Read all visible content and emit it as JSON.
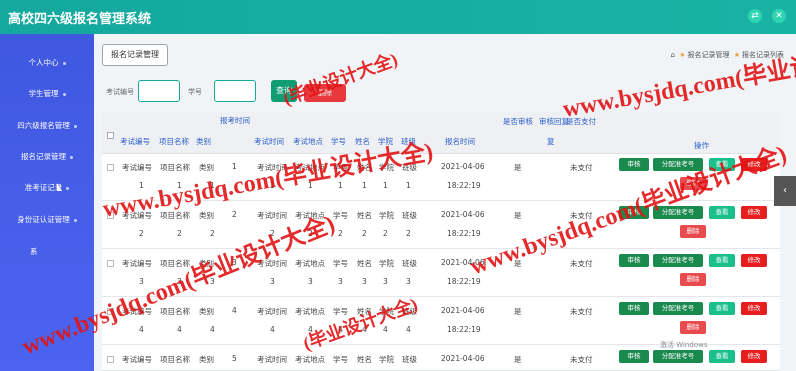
{
  "app": {
    "title": "高校四六级报名管理系统"
  },
  "window": {
    "btn_swap": "⇄",
    "btn_close": "✕"
  },
  "sidebar": {
    "items": [
      {
        "label": "个人中心"
      },
      {
        "label": "学生管理"
      },
      {
        "label": "四六级报名管理"
      },
      {
        "label": "报名记录管理"
      },
      {
        "label": "准考证记录"
      },
      {
        "label": "身份证认证管理"
      },
      {
        "label": "系"
      }
    ]
  },
  "page": {
    "tab_label": "报名记录管理",
    "breadcrumbs": [
      "报名记录管理",
      "报名记录列表"
    ]
  },
  "search": {
    "exam_no_label": "考试编号",
    "student_no_label": "学号",
    "search_button": "查询",
    "delete_button": "删除"
  },
  "table": {
    "top_header": "报考时间",
    "columns": [
      "考试编号",
      "项目名称",
      "类别",
      "考试时间",
      "考试地点",
      "学号",
      "姓名",
      "学院",
      "班级",
      "报名时间",
      "是否审核",
      "审核回复",
      "是否支付",
      "操作"
    ],
    "review_reply_line2": "复",
    "rows": [
      {
        "exam_no": "考试编号",
        "project": "项目名称",
        "category": "类别",
        "num": "1",
        "exam_time": "考试时间",
        "place": "考试地点",
        "sid": "学号",
        "name": "姓名",
        "college": "学院",
        "class": "班级",
        "date": "2021-04-06",
        "time": "18:22:19",
        "audited": "是",
        "paid": "未支付"
      },
      {
        "exam_no": "考试编号",
        "project": "项目名称",
        "category": "类别",
        "num": "2",
        "exam_time": "考试时间",
        "place": "考试地点",
        "sid": "学号",
        "name": "姓名",
        "college": "学院",
        "class": "班级",
        "date": "2021-04-06",
        "time": "18:22:19",
        "audited": "是",
        "paid": "未支付"
      },
      {
        "exam_no": "考试编号",
        "project": "项目名称",
        "category": "类别",
        "num": "3",
        "exam_time": "考试时间",
        "place": "考试地点",
        "sid": "学号",
        "name": "姓名",
        "college": "学院",
        "class": "班级",
        "date": "2021-04-06",
        "time": "18:22:19",
        "audited": "是",
        "paid": "未支付"
      },
      {
        "exam_no": "考试编号",
        "project": "项目名称",
        "category": "类别",
        "num": "4",
        "exam_time": "考试时间",
        "place": "考试地点",
        "sid": "学号",
        "name": "姓名",
        "college": "学院",
        "class": "班级",
        "date": "2021-04-06",
        "time": "18:22:19",
        "audited": "是",
        "paid": "未支付"
      },
      {
        "exam_no": "考试编号",
        "project": "项目名称",
        "category": "类别",
        "num": "5",
        "exam_time": "考试时间",
        "place": "考试地点",
        "sid": "学号",
        "name": "姓名",
        "college": "学院",
        "class": "班级",
        "date": "2021-04-06",
        "time": "",
        "audited": "是",
        "paid": "未支付"
      }
    ],
    "actions": {
      "audit": "审核",
      "assign": "分配准考号",
      "view": "查看",
      "edit": "修改",
      "delete": "删除"
    }
  },
  "watermarks": [
    "www.bysjdq.com(毕业设计大全)",
    "www.bysjdq.com(毕业设计大全)",
    "(毕业设计大全)",
    "www.bysjdq.com(毕业设计大全)",
    "www.bysjdq.com(毕业设计大全)",
    "(毕业设计大全)"
  ],
  "os_mark": "激活 Windows"
}
